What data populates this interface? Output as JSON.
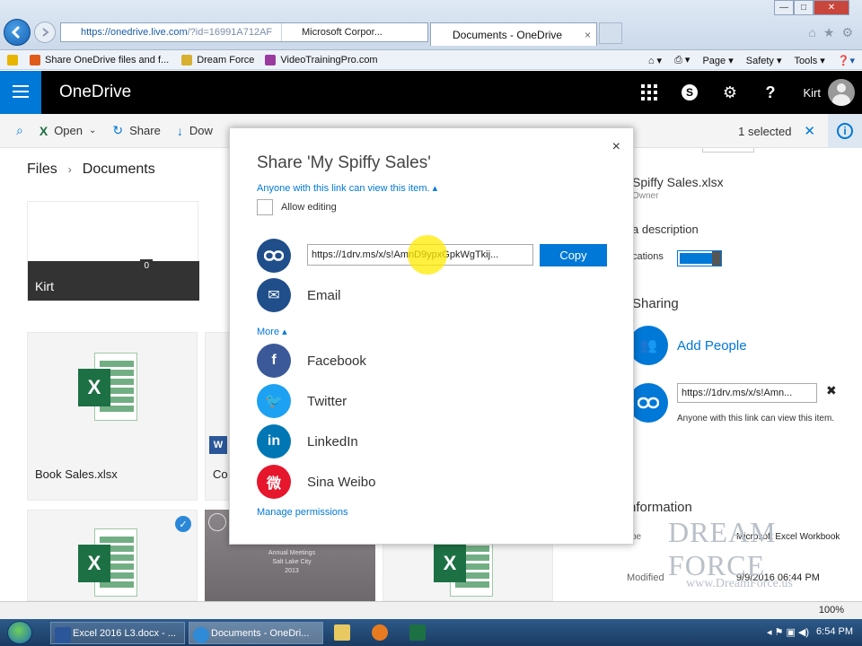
{
  "browser": {
    "url_main": "https://onedrive.",
    "url_domain": "live.com",
    "url_rest": "/?id=16991A712AF",
    "site_identity": "Microsoft Corpor...",
    "tab_title": "Documents - OneDrive",
    "tab_close": "×",
    "favorites": [
      "Share OneDrive files and f...",
      "Dream Force",
      "VideoTrainingPro.com"
    ],
    "commands": [
      "Page ▾",
      "Safety ▾",
      "Tools ▾"
    ],
    "win_controls": [
      "—",
      "□",
      "✕"
    ]
  },
  "onedrive": {
    "brand": "OneDrive",
    "user": "Kirt",
    "header_icons": [
      "apps-icon",
      "skype-icon",
      "gear-icon",
      "help-icon"
    ]
  },
  "cmdbar": {
    "open": "Open",
    "share": "Share",
    "download": "Dow",
    "selected": "1 selected",
    "clear": "✕",
    "info": "i"
  },
  "breadcrumb": {
    "root": "Files",
    "sep": "›",
    "current": "Documents"
  },
  "tiles": {
    "folder_name": "Kirt",
    "folder_count": "0",
    "file1": "Book Sales.xlsx",
    "file2_partial": "Co",
    "photo_text": "Annual Meetings\nSalt Lake City\n2013"
  },
  "dialog": {
    "title": "Share 'My Spiffy Sales'",
    "permission": "Anyone with this link can view this item. ▴",
    "allow_editing": "Allow editing",
    "link": "https://1drv.ms/x/s!AmnD9ypxGpkWgTkij...",
    "copy": "Copy",
    "email": "Email",
    "more": "More ▴",
    "facebook": "Facebook",
    "twitter": "Twitter",
    "linkedin": "LinkedIn",
    "weibo": "Sina Weibo",
    "manage": "Manage permissions",
    "close": "×"
  },
  "info_pane": {
    "filename": "Spiffy Sales.xlsx",
    "owner": "Owner",
    "description": "a description",
    "notifications": "cations",
    "sharing_heading": "Sharing",
    "add_people": "Add People",
    "link": "https://1drv.ms/x/s!Amn...",
    "link_note": "Anyone with this link can view this item.",
    "info_heading": "nformation",
    "type_label": "ype",
    "type_value": "Microsoft Excel Workbook",
    "modified_label": "Modified",
    "modified_value": "9/9/2016 06:44 PM"
  },
  "watermark": {
    "line1": "DREAM FORCE",
    "line2": "www.DreamForce.us"
  },
  "zoom": "100%",
  "taskbar": {
    "task1": "Excel 2016 L3.docx - ...",
    "task2": "Documents - OneDri...",
    "clock": "6:54 PM"
  },
  "colors": {
    "accent": "#0078d7",
    "excel": "#1d7044",
    "facebook": "#3b5998",
    "twitter": "#1da1f2",
    "linkedin": "#0077b5",
    "weibo": "#e6162d"
  }
}
